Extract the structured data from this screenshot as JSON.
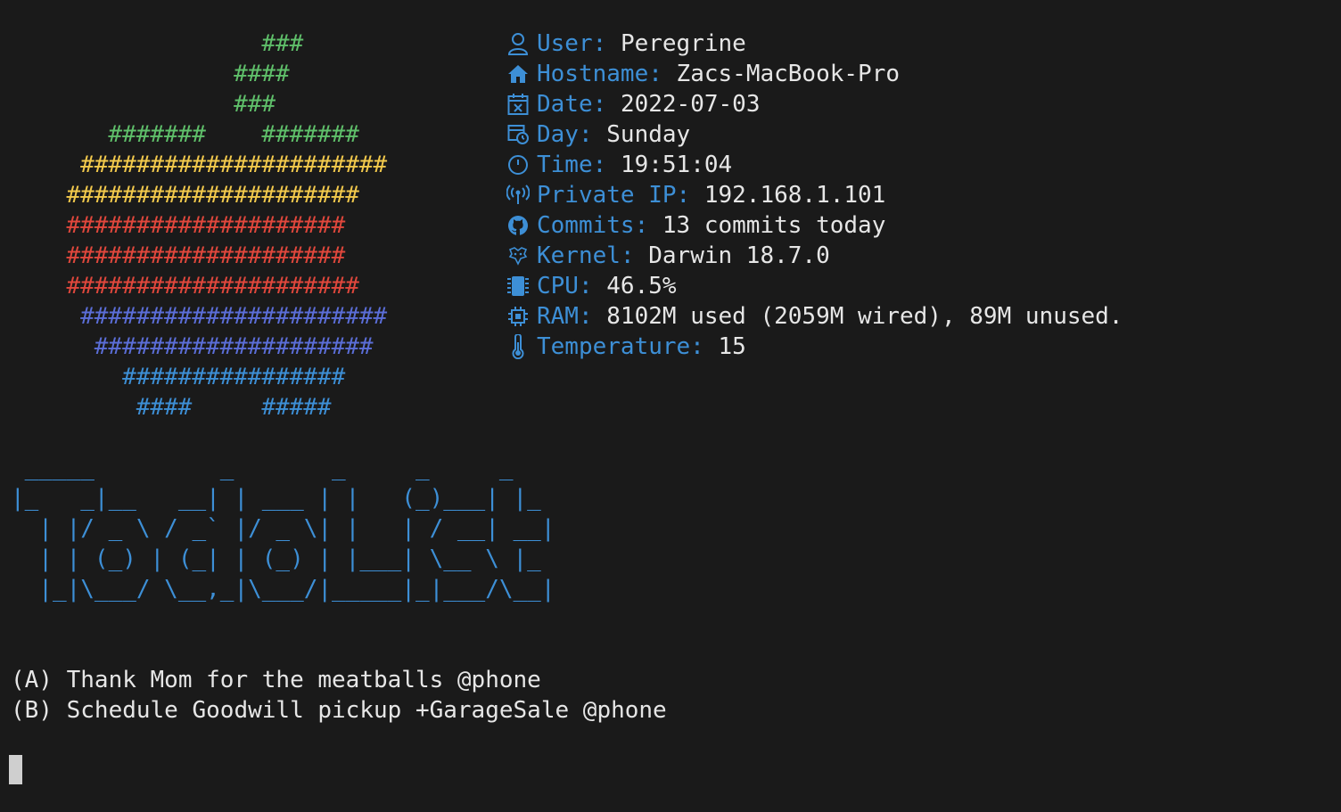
{
  "colors": {
    "background": "#1a1a1a",
    "text": "#e6e6e6",
    "key_blue": "#3d8fd6",
    "logo_green": "#5fbf6a",
    "logo_yellow": "#f2c94c",
    "logo_red": "#e0473c",
    "logo_indigo": "#5b6ed8",
    "logo_blue": "#3d8fd6"
  },
  "apple_logo": [
    {
      "text": "                  ###",
      "color": "green"
    },
    {
      "text": "                ####",
      "color": "green"
    },
    {
      "text": "                ###",
      "color": "green"
    },
    {
      "text": "       #######    #######",
      "color": "green"
    },
    {
      "text": "     ######################",
      "color": "yellow"
    },
    {
      "text": "    #####################",
      "color": "yellow"
    },
    {
      "text": "    ####################",
      "color": "red"
    },
    {
      "text": "    ####################",
      "color": "red"
    },
    {
      "text": "    #####################",
      "color": "red"
    },
    {
      "text": "     ######################",
      "color": "indigo"
    },
    {
      "text": "      ####################",
      "color": "indigo"
    },
    {
      "text": "        ################",
      "color": "blue"
    },
    {
      "text": "         ####     #####",
      "color": "blue"
    }
  ],
  "info": [
    {
      "icon": "user-icon",
      "key": "User:",
      "value": "Peregrine"
    },
    {
      "icon": "home-icon",
      "key": "Hostname:",
      "value": "Zacs-MacBook-Pro"
    },
    {
      "icon": "calendar-icon",
      "key": "Date:",
      "value": "2022-07-03"
    },
    {
      "icon": "calendar-clock-icon",
      "key": "Day:",
      "value": "Sunday"
    },
    {
      "icon": "clock-icon",
      "key": "Time:",
      "value": "19:51:04"
    },
    {
      "icon": "broadcast-icon",
      "key": "Private IP:",
      "value": "192.168.1.101"
    },
    {
      "icon": "github-icon",
      "key": "Commits:",
      "value": "13 commits today"
    },
    {
      "icon": "kernel-icon",
      "key": "Kernel:",
      "value": "Darwin 18.7.0"
    },
    {
      "icon": "cpu-icon",
      "key": "CPU:",
      "value": "46.5%"
    },
    {
      "icon": "chip-icon",
      "key": "RAM:",
      "value": "8102M used (2059M wired), 89M unused."
    },
    {
      "icon": "thermometer-icon",
      "key": "Temperature:",
      "value": "15"
    }
  ],
  "banner": [
    " _____         _       _     _     _",
    "|_   _|__   __| | ___ | |   (_)___| |_",
    "  | |/ _ \\ / _` |/ _ \\| |   | / __| __|",
    "  | | (_) | (_| | (_) | |___| \\__ \\ |_",
    "  |_|\\___/ \\__,_|\\___/|_____|_|___/\\__|"
  ],
  "todos": [
    "(A) Thank Mom for the meatballs @phone",
    "(B) Schedule Goodwill pickup +GarageSale @phone"
  ]
}
